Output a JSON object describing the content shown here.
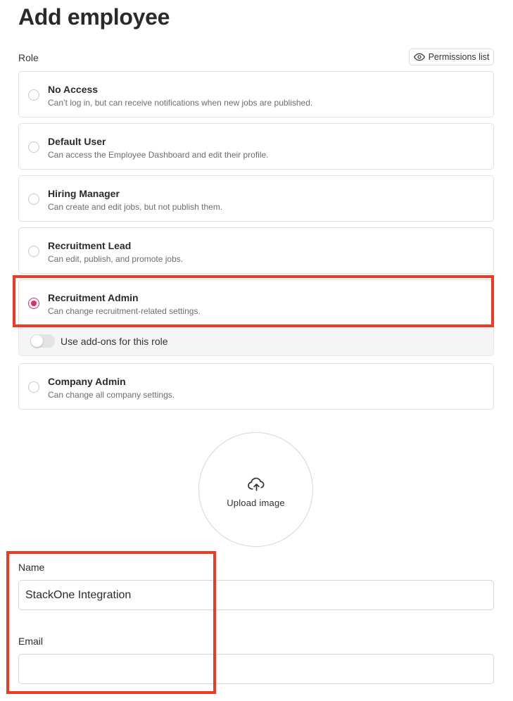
{
  "page": {
    "title": "Add employee"
  },
  "role": {
    "label": "Role",
    "permissions_button": "Permissions list",
    "options": [
      {
        "title": "No Access",
        "description": "Can’t log in, but can receive notifications when new jobs are published.",
        "selected": false
      },
      {
        "title": "Default User",
        "description": "Can access the Employee Dashboard and edit their profile.",
        "selected": false
      },
      {
        "title": "Hiring Manager",
        "description": "Can create and edit jobs, but not publish them.",
        "selected": false
      },
      {
        "title": "Recruitment Lead",
        "description": "Can edit, publish, and promote jobs.",
        "selected": false
      },
      {
        "title": "Recruitment Admin",
        "description": "Can change recruitment-related settings.",
        "selected": true
      },
      {
        "title": "Company Admin",
        "description": "Can change all company settings.",
        "selected": false
      }
    ],
    "addons": {
      "label": "Use add-ons for this role",
      "enabled": false
    }
  },
  "upload": {
    "label": "Upload image",
    "icon": "cloud-upload-icon"
  },
  "form": {
    "name": {
      "label": "Name",
      "value": "StackOne Integration"
    },
    "email": {
      "label": "Email",
      "value": ""
    }
  },
  "colors": {
    "accent": "#e8286b",
    "annotation": "#ee3a23"
  }
}
